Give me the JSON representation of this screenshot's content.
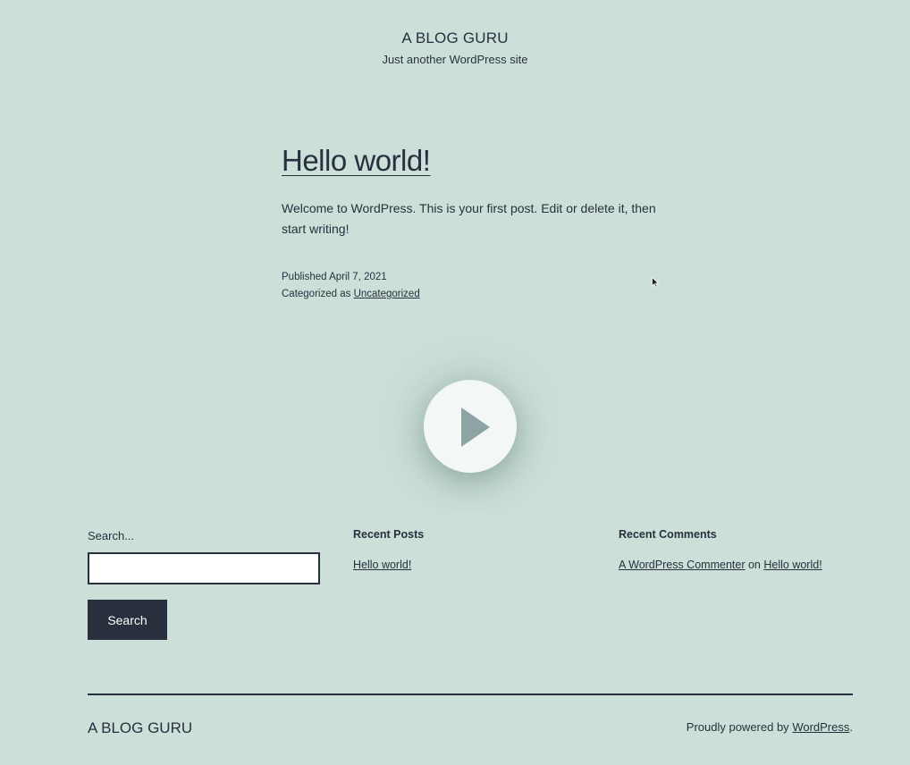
{
  "header": {
    "site_title": "A BLOG GURU",
    "tagline": "Just another WordPress site"
  },
  "post": {
    "title": "Hello world!",
    "body": "Welcome to WordPress. This is your first post. Edit or delete it, then start writing!",
    "published_label": "Published",
    "published_date": "April 7, 2021",
    "categorized_label": "Categorized as",
    "category": "Uncategorized"
  },
  "video": {
    "icon": "play-icon"
  },
  "widgets": {
    "search": {
      "label": "Search...",
      "value": "",
      "button_label": "Search"
    },
    "recent_posts": {
      "heading": "Recent Posts",
      "items": [
        {
          "label": "Hello world!"
        }
      ]
    },
    "recent_comments": {
      "heading": "Recent Comments",
      "items": [
        {
          "author": "A WordPress Commenter",
          "connector": "on",
          "post": "Hello world!"
        }
      ]
    }
  },
  "footer": {
    "site_title": "A BLOG GURU",
    "powered_prefix": "Proudly powered by",
    "powered_link": "WordPress",
    "powered_suffix": "."
  },
  "colors": {
    "background": "#cce0d9",
    "text": "#28303d",
    "button": "#28303d"
  }
}
